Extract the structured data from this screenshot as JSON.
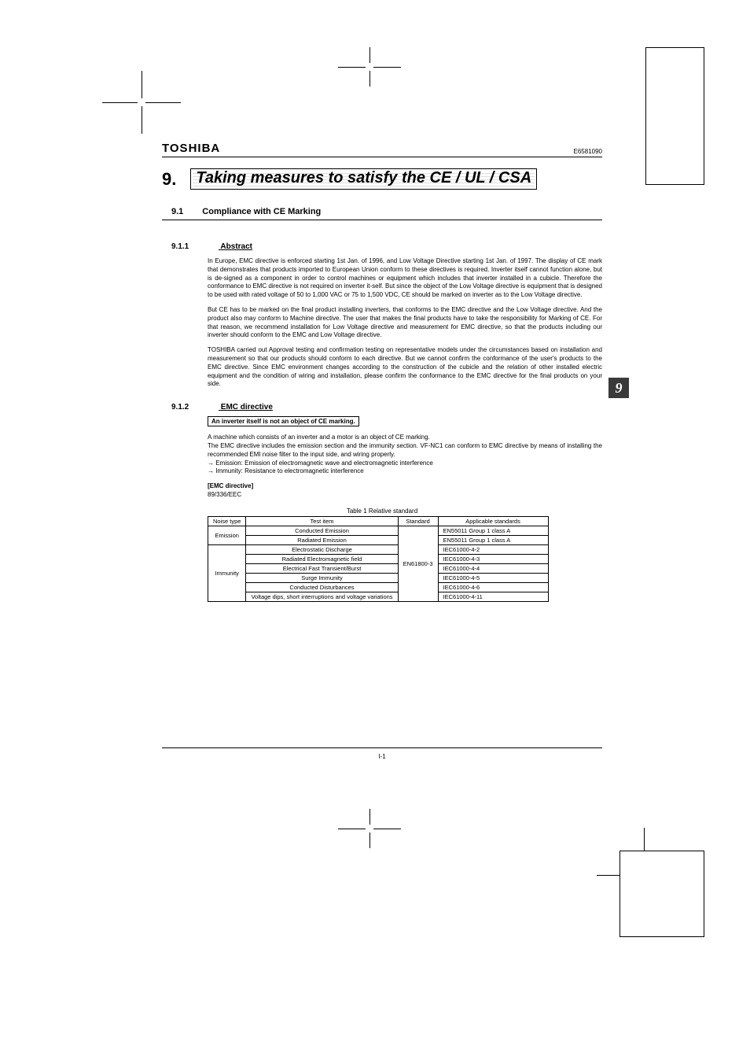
{
  "doc": {
    "brand": "TOSHIBA",
    "docnum": "E6581090",
    "pagenum": "I-1",
    "side_tab": "9"
  },
  "chapter": {
    "number": "9.",
    "title": "Taking measures to satisfy the CE / UL / CSA"
  },
  "sec": {
    "number": "9.1",
    "title": "Compliance with CE Marking"
  },
  "sub1": {
    "num": "9.1.1",
    "title": "Abstract",
    "p1": "In Europe, EMC directive is enforced starting 1st Jan. of 1996, and Low Voltage Directive starting 1st Jan. of 1997. The display of CE mark that demonstrates that products imported to European Union conform to these directives is required. Inverter itself cannot function alone, but is de-signed as a component in order to control machines or equipment which includes that inverter installed in a cubicle. Therefore the conformance to EMC directive is not required on inverter it-self. But since the object of the Low Voltage directive is equipment that is designed to be used with rated voltage of 50 to 1,000 VAC or 75 to 1,500 VDC, CE should be marked on inverter as to the Low Voltage directive.",
    "p2": "But CE has to be marked on the final product installing inverters, that conforms to the EMC directive and the Low Voltage directive. And the product also may conform to Machine directive. The user that makes the final products have to take the responsibility for Marking of CE. For that reason, we recommend installation for Low Voltage directive and measurement for EMC directive, so that the products including our inverter should conform to the EMC and Low Voltage directive.",
    "p3": "TOSHIBA carried out Approval testing and confirmation testing on representative models under the circumstances based on installation and measurement so that our products should conform to each directive. But we cannot confirm the conformance of the user's products to the EMC directive. Since EMC environment changes according to the construction of the cubicle and the relation of other installed electric equipment and the condition of wiring and installation, please confirm the conformance to the EMC directive for the final products on your side."
  },
  "sub2": {
    "num": "9.1.2",
    "title": "EMC  directive",
    "boxed": "An inverter itself is not an object of CE marking.",
    "p1": "A machine which consists of an inverter and a motor is an object of CE marking.",
    "p2": "The EMC directive includes the emission section and the immunity section. VF-NC1 can conform to EMC directive by means of installing the recommended EMI noise filter to the input side, and wiring properly.",
    "p3": "→ Emission: Emission of electromagnetic wave and electromagnetic interference",
    "p4": "→ Immunity: Resistance to electromagnetic interference",
    "dir_label": "[EMC directive]",
    "dir_code": "89/336/EEC",
    "table_caption": "Table 1 Relative standard",
    "headers": {
      "c1": "Noise type",
      "c2": "Test item",
      "c3": "Standard",
      "c4": "Applicable standards"
    },
    "standard_shared": "EN61800-3",
    "groups": [
      {
        "type": "Emission",
        "rows": [
          {
            "item": "Conducted Emission",
            "std": "EN55011 Group 1 class A"
          },
          {
            "item": "Radiated Emission",
            "std": "EN55011 Group 1 class A"
          }
        ]
      },
      {
        "type": "Immunity",
        "rows": [
          {
            "item": "Electrostatic Discharge",
            "std": "IEC61000-4-2"
          },
          {
            "item": "Radiated Electromagnetic field",
            "std": "IEC61000-4-3"
          },
          {
            "item": "Electrical Fast Transient/Burst",
            "std": "IEC61000-4-4"
          },
          {
            "item": "Surge Immunity",
            "std": "IEC61000-4-5"
          },
          {
            "item": "Conducted Disturbances",
            "std": "IEC61000-4-6"
          },
          {
            "item": "Voltage dips, short interruptions and voltage variations",
            "std": "IEC61000-4-11"
          }
        ]
      }
    ]
  }
}
